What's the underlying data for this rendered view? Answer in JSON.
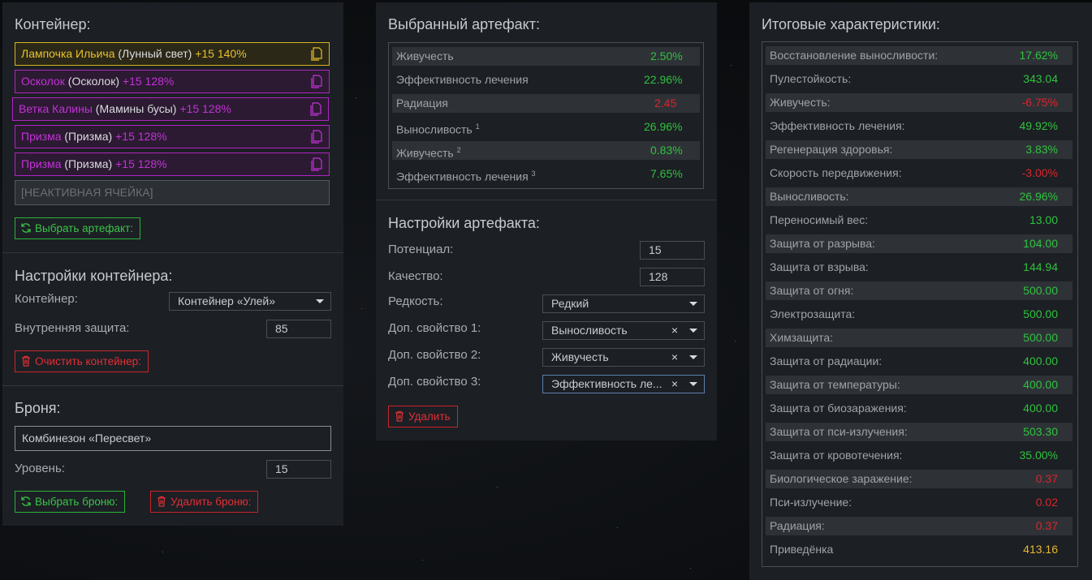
{
  "container_panel": {
    "title": "Контейнер:",
    "slots": [
      {
        "name": "Лампочка Ильича",
        "base": "(Лунный свет)",
        "bonus": "+15 140%"
      },
      {
        "name": "Осколок",
        "base": "(Осколок)",
        "bonus": "+15 128%"
      },
      {
        "name": "Ветка Калины",
        "base": "(Мамины бусы)",
        "bonus": "+15 128%"
      },
      {
        "name": "Призма",
        "base": "(Призма)",
        "bonus": "+15 128%"
      },
      {
        "name": "Призма",
        "base": "(Призма)",
        "bonus": "+15 128%"
      }
    ],
    "inactive_slot": "[НЕАКТИВНАЯ ЯЧЕЙКА]",
    "select_artifact_button": "Выбрать артефакт:",
    "settings_title": "Настройки контейнера:",
    "container_label": "Контейнер:",
    "container_value": "Контейнер «Улей»",
    "inner_protection_label": "Внутренняя защита:",
    "inner_protection_value": "85",
    "clear_button": "Очистить контейнер:",
    "armor_title": "Броня:",
    "armor_value": "Комбинезон «Пересвет»",
    "level_label": "Уровень:",
    "level_value": "15",
    "select_armor_button": "Выбрать броню:",
    "delete_armor_button": "Удалить броню:"
  },
  "artifact_panel": {
    "title": "Выбранный артефакт:",
    "stats": [
      {
        "name": "Живучесть",
        "sup": "",
        "value": "2.50%",
        "color": "green"
      },
      {
        "name": "Эффективность лечения",
        "sup": "",
        "value": "22.96%",
        "color": "green"
      },
      {
        "name": "Радиация",
        "sup": "",
        "value": "2.45",
        "color": "red"
      },
      {
        "name": "Выносливость",
        "sup": "1",
        "value": "26.96%",
        "color": "green"
      },
      {
        "name": "Живучесть",
        "sup": "2",
        "value": "0.83%",
        "color": "green"
      },
      {
        "name": "Эффективность лечения",
        "sup": "3",
        "value": "7.65%",
        "color": "green"
      }
    ],
    "settings_title": "Настройки артефакта:",
    "potential_label": "Потенциал:",
    "potential_value": "15",
    "quality_label": "Качество:",
    "quality_value": "128",
    "rarity_label": "Редкость:",
    "rarity_value": "Редкий",
    "extra1_label": "Доп. свойство 1:",
    "extra1_value": "Выносливость",
    "extra2_label": "Доп. свойство 2:",
    "extra2_value": "Живучесть",
    "extra3_label": "Доп. свойство 3:",
    "extra3_value": "Эффективность ле...",
    "clear_glyph": "×",
    "delete_button": "Удалить"
  },
  "totals_panel": {
    "title": "Итоговые характеристики:",
    "stats": [
      {
        "name": "Восстановление выносливости:",
        "value": "17.62%",
        "color": "green"
      },
      {
        "name": "Пулестойкость:",
        "value": "343.04",
        "color": "green"
      },
      {
        "name": "Живучесть:",
        "value": "-6.75%",
        "color": "red"
      },
      {
        "name": "Эффективность лечения:",
        "value": "49.92%",
        "color": "green"
      },
      {
        "name": "Регенерация здоровья:",
        "value": "3.83%",
        "color": "green"
      },
      {
        "name": "Скорость передвижения:",
        "value": "-3.00%",
        "color": "red"
      },
      {
        "name": "Выносливость:",
        "value": "26.96%",
        "color": "green"
      },
      {
        "name": "Переносимый вес:",
        "value": "13.00",
        "color": "green"
      },
      {
        "name": "Защита от разрыва:",
        "value": "104.00",
        "color": "green"
      },
      {
        "name": "Защита от взрыва:",
        "value": "144.94",
        "color": "green"
      },
      {
        "name": "Защита от огня:",
        "value": "500.00",
        "color": "green"
      },
      {
        "name": "Электрозащита:",
        "value": "500.00",
        "color": "green"
      },
      {
        "name": "Химзащита:",
        "value": "500.00",
        "color": "green"
      },
      {
        "name": "Защита от радиации:",
        "value": "400.00",
        "color": "green"
      },
      {
        "name": "Защита от температуры:",
        "value": "400.00",
        "color": "green"
      },
      {
        "name": "Защита от биозаражения:",
        "value": "400.00",
        "color": "green"
      },
      {
        "name": "Защита от пси-излучения:",
        "value": "503.30",
        "color": "green"
      },
      {
        "name": "Защита от кровотечения:",
        "value": "35.00%",
        "color": "green"
      },
      {
        "name": "Биологическое заражение:",
        "value": "0.37",
        "color": "red"
      },
      {
        "name": "Пси-излучение:",
        "value": "0.02",
        "color": "red"
      },
      {
        "name": "Радиация:",
        "value": "0.37",
        "color": "red"
      },
      {
        "name": "Приведёнка",
        "value": "413.16",
        "color": "gold"
      }
    ]
  },
  "colors": {
    "panel_bg": "#1c1f24",
    "gold": "#e7c12c",
    "purple": "#c232d6",
    "green": "#2fc23e",
    "red": "#d6262c"
  }
}
